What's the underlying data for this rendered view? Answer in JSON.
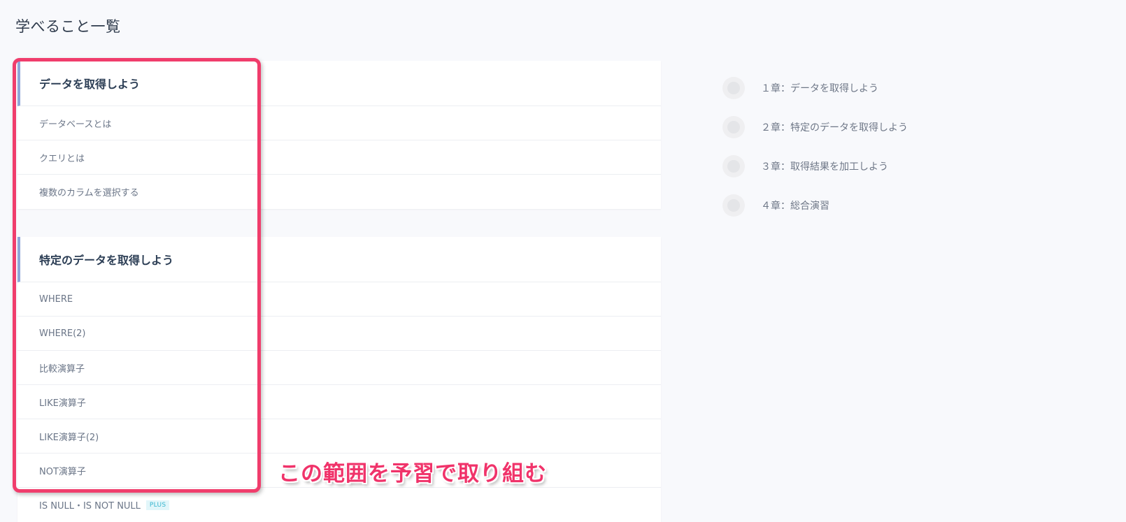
{
  "page": {
    "title": "学べること一覧"
  },
  "chapters": [
    {
      "title": "データを取得しよう",
      "lessons": [
        {
          "label": "データベースとは"
        },
        {
          "label": "クエリとは"
        },
        {
          "label": "複数のカラムを選択する"
        }
      ]
    },
    {
      "title": "特定のデータを取得しよう",
      "lessons": [
        {
          "label": "WHERE"
        },
        {
          "label": "WHERE(2)"
        },
        {
          "label": "比較演算子"
        },
        {
          "label": "LIKE演算子"
        },
        {
          "label": "LIKE演算子(2)"
        },
        {
          "label": "NOT演算子"
        },
        {
          "label": "IS NULL・IS NOT NULL",
          "badge": "PLUS"
        }
      ]
    }
  ],
  "annotation": {
    "text": "この範囲を予習で取り組む",
    "color": "#f0336a"
  },
  "toc": {
    "items": [
      {
        "label": "１章：データを取得しよう"
      },
      {
        "label": "２章：特定のデータを取得しよう"
      },
      {
        "label": "３章：取得結果を加工しよう"
      },
      {
        "label": "４章：総合演習"
      }
    ]
  },
  "colors": {
    "accent_border": "#8fa6d9",
    "highlight": "#f03d6c",
    "badge_text": "#39b6cf"
  }
}
